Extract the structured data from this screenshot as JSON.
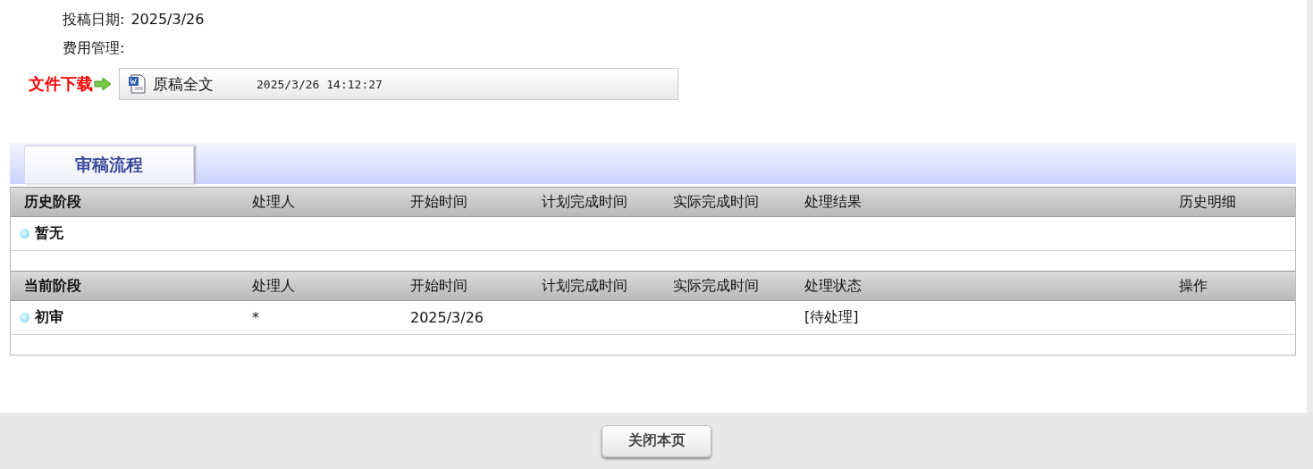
{
  "fields": [
    {
      "label": "投稿日期:",
      "value": "2025/3/26"
    },
    {
      "label": "费用管理:"
    }
  ],
  "file_download": {
    "label": "文件下载",
    "file_name": "原稿全文",
    "time": "2025/3/26 14:12:27"
  },
  "section_tab": {
    "label": "审稿流程",
    "selected": true
  },
  "stage_tables": [
    {
      "columns": [
        "历史阶段",
        "处理人",
        "开始时间",
        "计划完成时间",
        "实际完成时间",
        "处理结果",
        "历史明细"
      ],
      "rows": [
        [
          "暂无"
        ]
      ]
    },
    {
      "columns": [
        "当前阶段",
        "处理人",
        "开始时间",
        "计划完成时间",
        "实际完成时间",
        "处理状态",
        "操作"
      ],
      "rows": [
        [
          "初审",
          "*",
          "2025/3/26",
          "",
          "",
          "[待处理]"
        ]
      ]
    }
  ],
  "close_button": "关闭本页"
}
